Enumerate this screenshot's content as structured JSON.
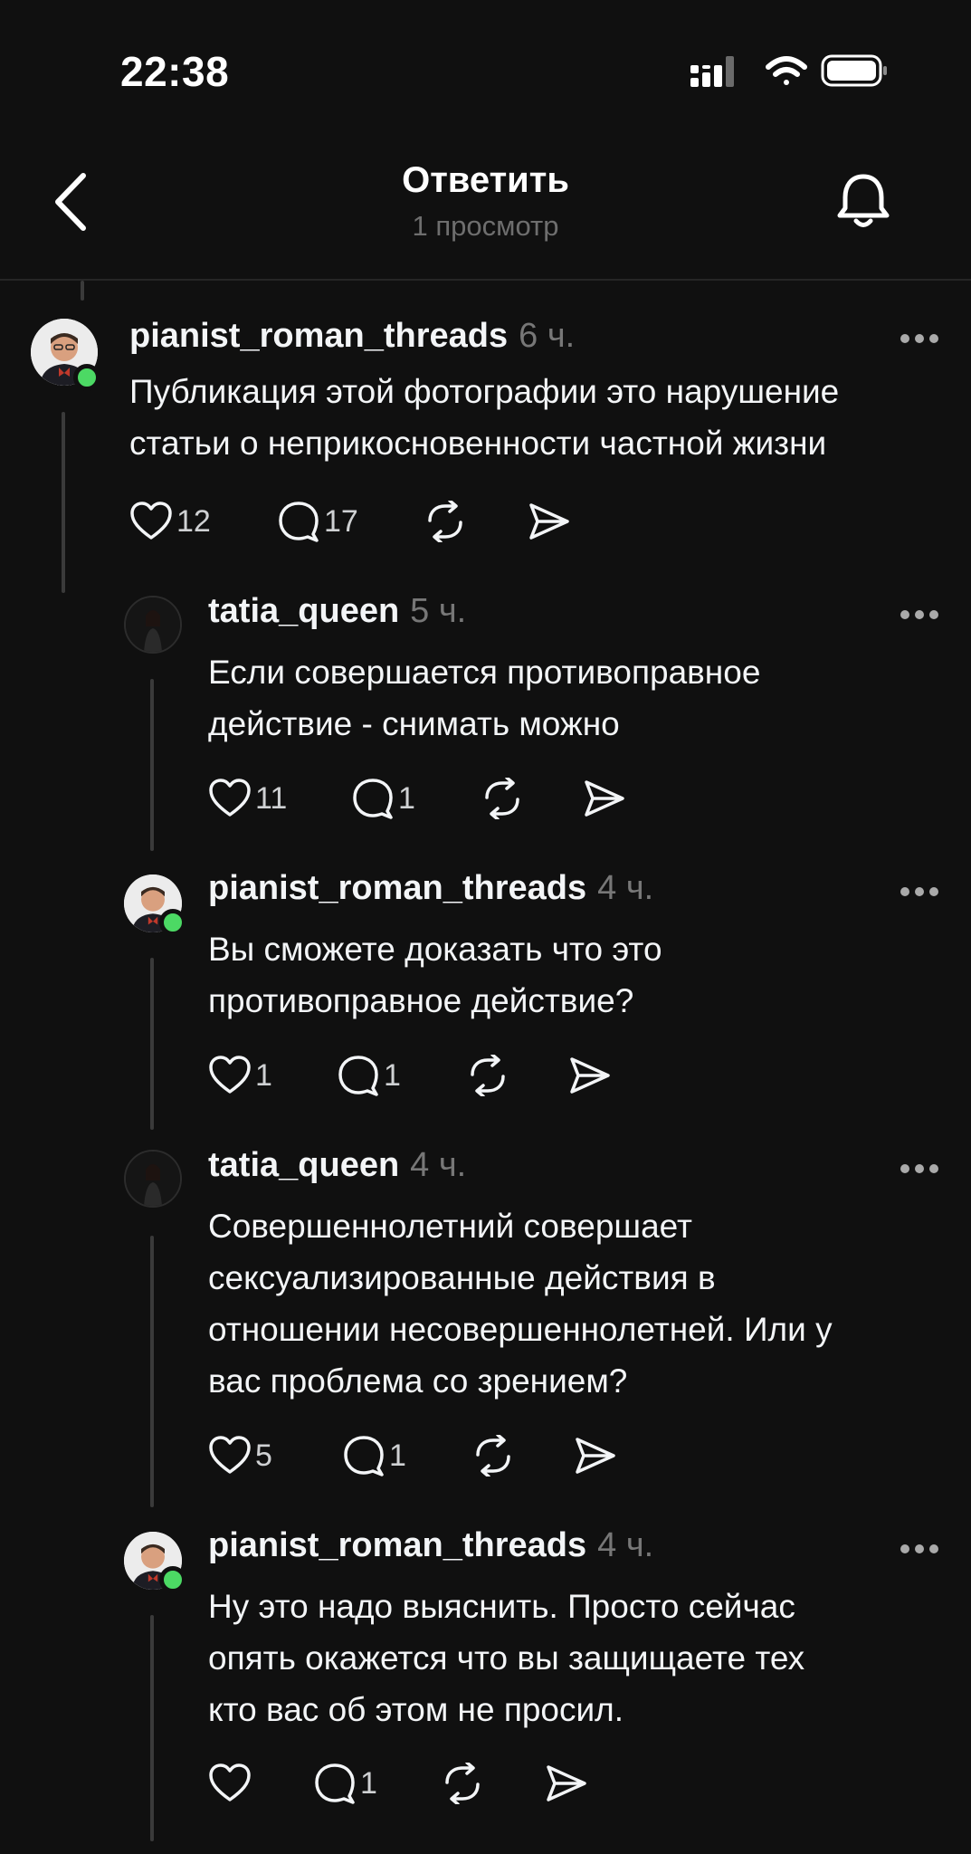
{
  "status_bar": {
    "time": "22:38",
    "icons": [
      "cellular-signal-icon",
      "wifi-icon",
      "battery-icon"
    ]
  },
  "header": {
    "title": "Ответить",
    "subtitle": "1 просмотр",
    "back_icon": "chevron-left-icon",
    "bell_icon": "bell-icon"
  },
  "colors": {
    "background": "#101010",
    "text": "#f3f5f7",
    "muted": "#777777",
    "online": "#4cd964"
  },
  "posts": [
    {
      "username": "pianist_roman_threads",
      "time": "6 ч.",
      "text": "Публикация этой фотографии это нарушение статьи о неприкосновенности частной жизни",
      "likes": "12",
      "replies": "17"
    },
    {
      "username": "tatia_queen",
      "time": "5 ч.",
      "text": "Если совершается противоправное\nдействие - снимать можно",
      "likes": "11",
      "replies": "1"
    },
    {
      "username": "pianist_roman_threads",
      "time": "4 ч.",
      "text": "Вы сможете доказать что это\nпротивоправное действие?",
      "likes": "1",
      "replies": "1"
    },
    {
      "username": "tatia_queen",
      "time": "4 ч.",
      "text": "Совершеннолетний совершает\nсексуализированные действия в\nотношении несовершеннолетней. Или у\nвас проблема со зрением?",
      "likes": "5",
      "replies": "1"
    },
    {
      "username": "pianist_roman_threads",
      "time": "4 ч.",
      "text": "Ну это надо выяснить. Просто сейчас\nопять окажется что вы защищаете тех\nкто вас об этом не просил.",
      "likes": "",
      "replies": "1"
    }
  ]
}
